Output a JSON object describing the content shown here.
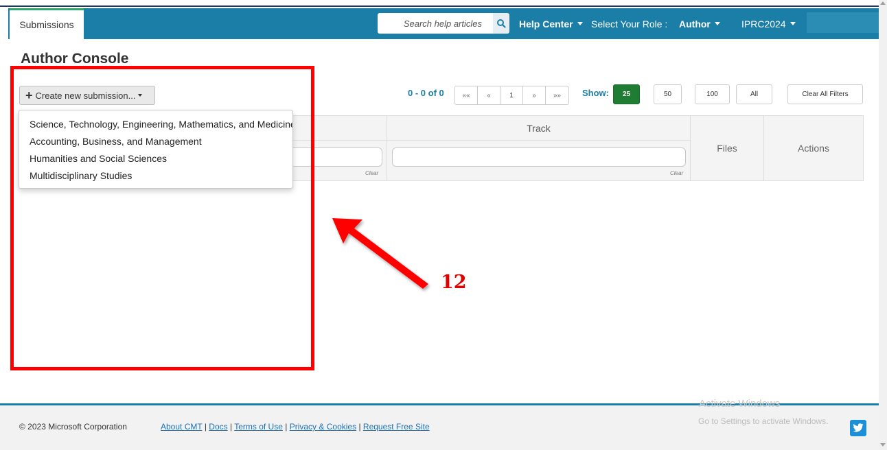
{
  "navbar": {
    "tab_submissions": "Submissions",
    "search_placeholder": "Search help articles",
    "help_center": "Help Center",
    "role_label": "Select Your Role :",
    "role_value": "Author",
    "conference": "IPRC2024"
  },
  "page": {
    "title": "Author Console"
  },
  "create": {
    "label": "Create new submission..."
  },
  "dropdown": {
    "items": [
      "Science, Technology, Engineering, Mathematics, and Medicine",
      "Accounting, Business, and Management",
      "Humanities and Social Sciences",
      "Multidisciplinary Studies"
    ]
  },
  "pager": {
    "count": "0 - 0 of 0",
    "first": "««",
    "prev": "«",
    "current": "1",
    "next": "»",
    "last": "»»"
  },
  "show": {
    "label": "Show:",
    "options": [
      "25",
      "50",
      "100",
      "All"
    ],
    "active": "25",
    "clear_filters": "Clear All Filters"
  },
  "table": {
    "headers": {
      "track": "Track",
      "files": "Files",
      "actions": "Actions"
    },
    "clear_label": "Clear"
  },
  "annotation": {
    "number": "12",
    "color": "#ff0000"
  },
  "footer": {
    "copyright": "© 2023 Microsoft Corporation",
    "links": [
      "About CMT",
      "Docs",
      "Terms of Use",
      "Privacy & Cookies",
      "Request Free Site"
    ],
    "separator": "|"
  },
  "watermark": {
    "line1": "Activate Windows",
    "line2": "Go to Settings to activate Windows."
  },
  "colors": {
    "navbar": "#1b7ea6",
    "accent_green": "#1e7d32",
    "link_blue": "#1b6fb5"
  },
  "icons": {
    "search": "search-icon",
    "twitter": "twitter-icon",
    "plus": "plus-icon"
  }
}
